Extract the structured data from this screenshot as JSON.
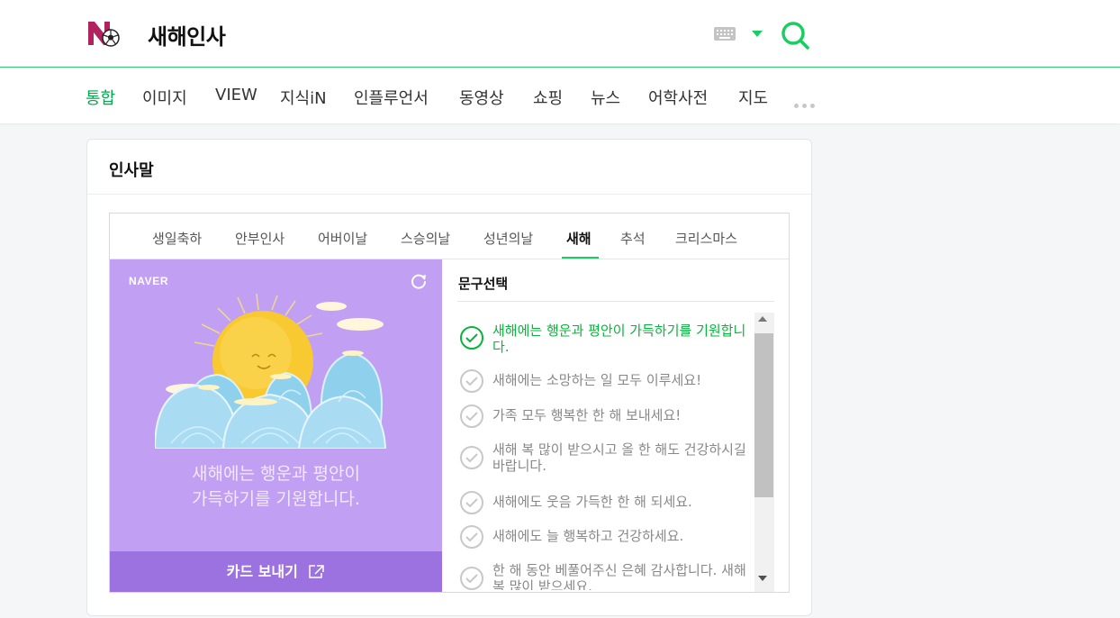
{
  "header": {
    "logo_icon": "naver-soccer-logo-icon",
    "query": "새해인사",
    "keyboard_icon": "keyboard-icon",
    "dropdown_icon": "caret-down-icon",
    "search_icon": "search-icon",
    "accent_color": "#19ce60"
  },
  "nav": {
    "items": [
      "통합",
      "이미지",
      "VIEW",
      "지식iN",
      "인플루언서",
      "동영상",
      "쇼핑",
      "뉴스",
      "어학사전",
      "지도"
    ],
    "active": "통합",
    "more_icon": "more-dots-icon"
  },
  "card": {
    "title": "인사말",
    "tabs": [
      "생일축하",
      "안부인사",
      "어버이날",
      "스승의날",
      "성년의날",
      "새해",
      "추석",
      "크리스마스"
    ],
    "active_tab": "새해",
    "preview": {
      "brand": "NAVER",
      "refresh_icon": "refresh-icon",
      "illustration": "sun-and-waves-illustration",
      "message_lines": [
        "새해에는 행운과 평안이",
        "가득하기를 기원합니다."
      ],
      "background_color": "#c19ff2",
      "send_label": "카드 보내기",
      "send_icon": "share-external-icon"
    },
    "phrases": {
      "title": "문구선택",
      "check_icon": "check-circle-icon",
      "items": [
        "새해에는 행운과 평안이 가득하기를 기원합니다.",
        "새해에는 소망하는 일 모두 이루세요!",
        "가족 모두 행복한 한 해 보내세요!",
        "새해 복 많이 받으시고 올 한 해도 건강하시길 바랍니다.",
        "새해에도 웃음 가득한 한 해 되세요.",
        "새해에도 늘 행복하고 건강하세요.",
        "한 해 동안 베풀어주신 은혜 감사합니다. 새해 복 많이 받으세요."
      ],
      "selected_index": 0,
      "selected_color": "#07b53b"
    }
  }
}
